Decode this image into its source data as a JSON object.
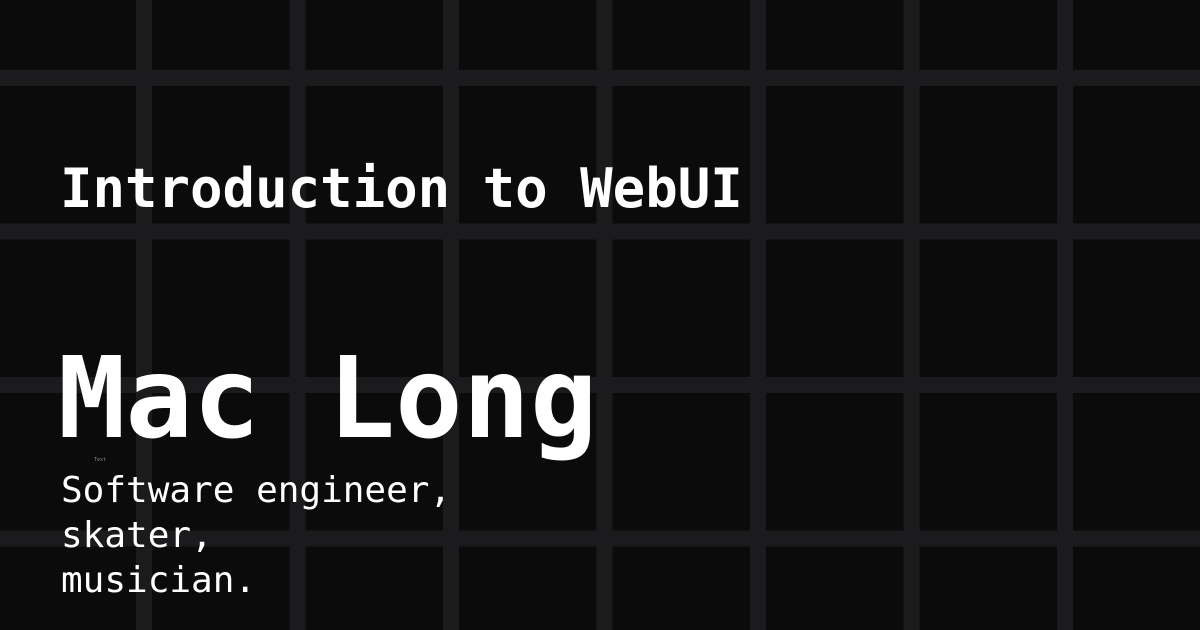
{
  "title": "Introduction to WebUI",
  "author": {
    "name": "Mac Long",
    "tag": "Text"
  },
  "bio": [
    "Software engineer,",
    "skater,",
    "musician."
  ],
  "colors": {
    "background": "#0b0b0c",
    "grid": "#1b1b1d",
    "text": "#ffffff"
  }
}
